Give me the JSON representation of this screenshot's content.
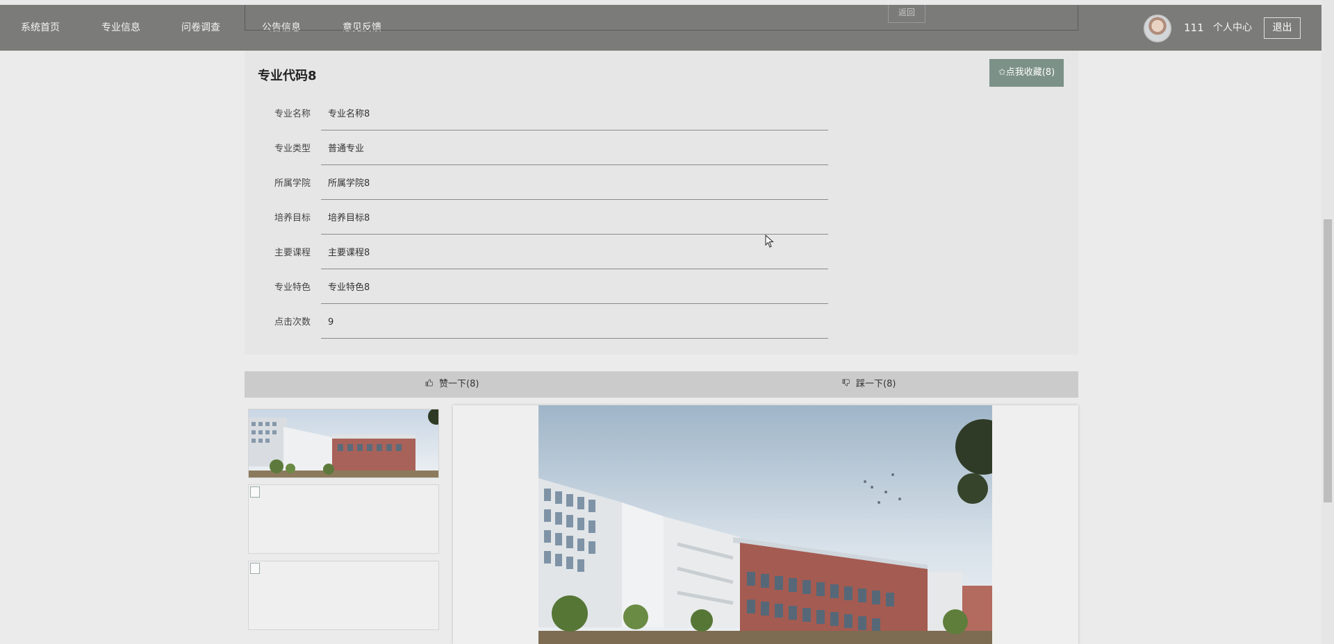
{
  "nav": {
    "items": [
      "系统首页",
      "专业信息",
      "问卷调查",
      "公告信息",
      "意见反馈"
    ],
    "back_label": "返回",
    "user_id": "111",
    "personal_center": "个人中心",
    "logout": "退出"
  },
  "detail": {
    "title": "专业代码8",
    "favorite_label": "✩点我收藏(8)",
    "fields": [
      {
        "label": "专业名称",
        "value": "专业名称8"
      },
      {
        "label": "专业类型",
        "value": "普通专业"
      },
      {
        "label": "所属学院",
        "value": "所属学院8"
      },
      {
        "label": "培养目标",
        "value": "培养目标8"
      },
      {
        "label": "主要课程",
        "value": "主要课程8"
      },
      {
        "label": "专业特色",
        "value": "专业特色8"
      },
      {
        "label": "点击次数",
        "value": "9"
      }
    ]
  },
  "votes": {
    "like_label": "赞一下(8)",
    "dislike_label": "踩一下(8)"
  },
  "colors": {
    "nav_bg": "#7b7b7a",
    "favorite_bg": "#7c9188",
    "vote_bar_bg": "#cbcbcb"
  },
  "icons": {
    "like": "thumbs-up-icon",
    "dislike": "thumbs-down-icon",
    "broken_image": "broken-image-icon"
  }
}
